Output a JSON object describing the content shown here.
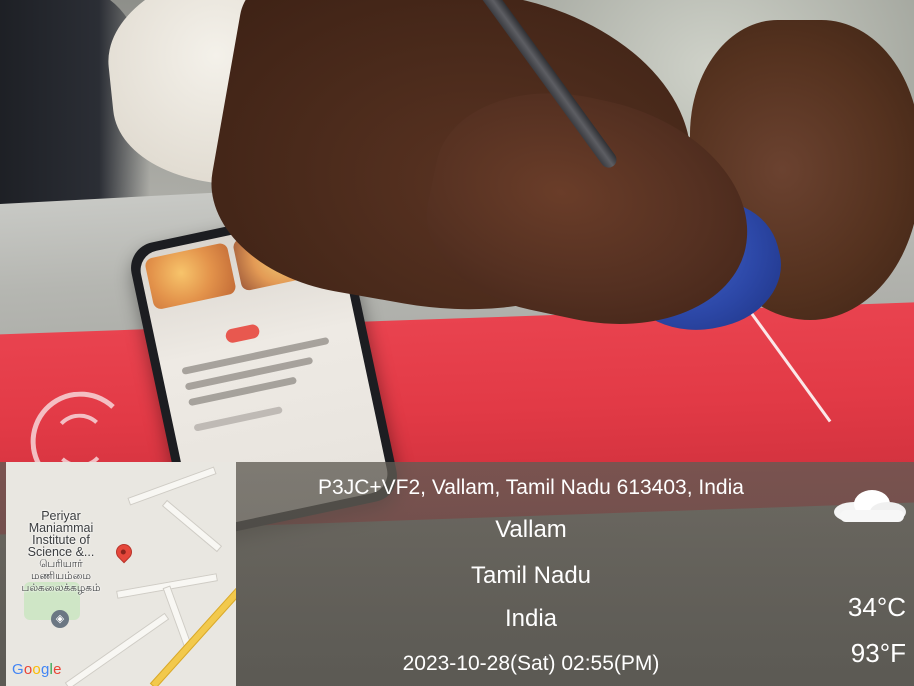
{
  "overlay": {
    "address": "P3JC+VF2, Vallam, Tamil Nadu 613403, India",
    "city": "Vallam",
    "state": "Tamil Nadu",
    "country": "India",
    "datetime": "2023-10-28(Sat)   02:55(PM)"
  },
  "map": {
    "poi_label_lines": [
      "Periyar",
      "Maniammai",
      "Institute of",
      "Science &..."
    ],
    "poi_label_tamil_lines": [
      "பெரியார்",
      "மணியம்மை",
      "பல்கலைக்கழகம்"
    ],
    "brand": "Google",
    "pin_icon": "map-pin-icon",
    "school_icon": "graduation-cap-icon"
  },
  "weather": {
    "icon": "cloud-icon",
    "temp_c": "34°C",
    "temp_f": "93°F"
  },
  "colors": {
    "overlay_text": "#ffffff",
    "pin": "#e5473b",
    "table_sheet": "#e23a46",
    "soap": "#2c47a6"
  }
}
